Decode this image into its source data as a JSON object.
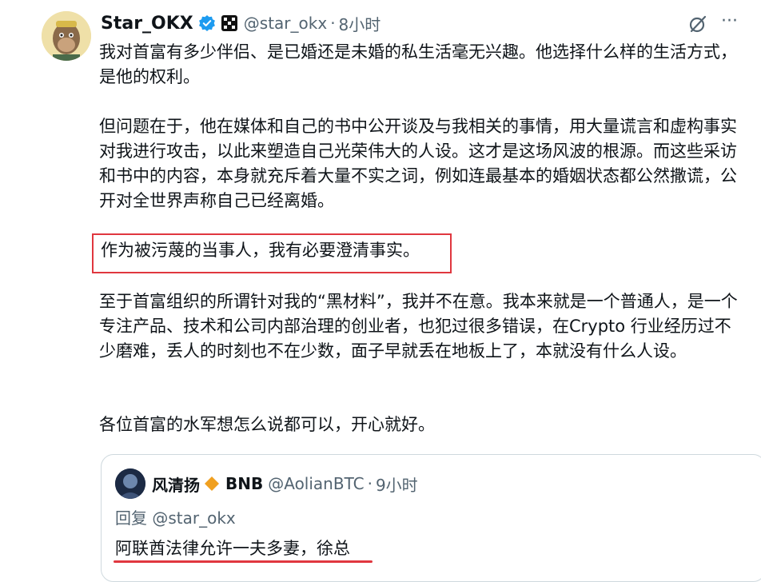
{
  "tweet": {
    "display_name": "Star_OKX",
    "handle": "@star_okx",
    "separator": "·",
    "time": "8小时",
    "more_label": "···",
    "paragraphs": [
      "我对首富有多少伴侣、是已婚还是未婚的私生活毫无兴趣。他选择什么样的生活方式，是他的权利。",
      "但问题在于，他在媒体和自己的书中公开谈及与我相关的事情，用大量谎言和虚构事实对我进行攻击，以此来塑造自己光荣伟大的人设。这才是这场风波的根源。而这些采访和书中的内容，本身就充斥着大量不实之词，例如连最基本的婚姻状态都公然撒谎，公开对全世界声称自己已经离婚。",
      "作为被污蔑的当事人，我有必要澄清事实。",
      "至于首富组织的所谓针对我的“黑材料”，我并不在意。我本来就是一个普通人，是一个专注产品、技术和公司内部治理的创业者，也犯过很多错误，在Crypto 行业经历过不少磨难，丢人的时刻也不在少数，面子早就丢在地板上了，本就没有什么人设。",
      "各位首富的水军想怎么说都可以，开心就好。"
    ]
  },
  "quoted": {
    "display_name": "风清扬",
    "tag": "BNB",
    "handle": "@AolianBTC",
    "separator": "·",
    "time": "9小时",
    "reply_to": "回复 @star_okx",
    "text": "阿联酋法律允许一夫多妻，徐总"
  },
  "colors": {
    "verified_badge": "#1d9bf0",
    "highlight_red": "#e0373f",
    "secondary_text": "#536471",
    "diamond": "#f0a020"
  },
  "icons": [
    "verified-badge-icon",
    "okx-logo-icon",
    "grok-icon",
    "more-icon",
    "diamond-icon"
  ]
}
